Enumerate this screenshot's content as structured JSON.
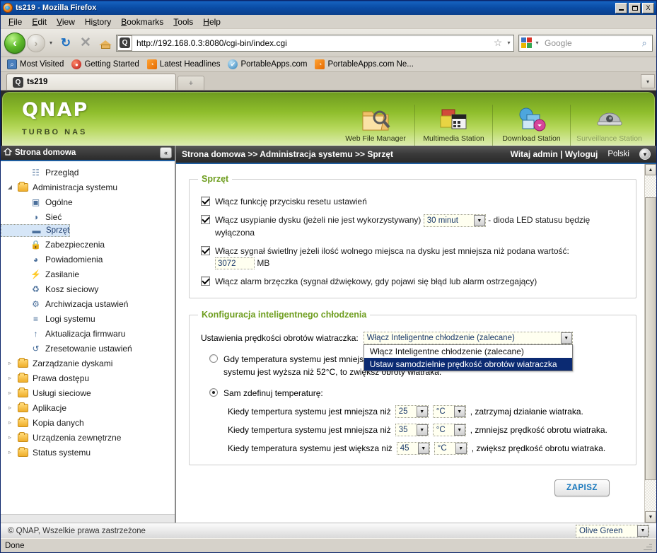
{
  "window": {
    "title": "ts219 - Mozilla Firefox",
    "icon": "firefox-icon",
    "minimize": "minimize-button",
    "maximize": "maximize-button",
    "close_label": "X"
  },
  "menu": [
    "File",
    "Edit",
    "View",
    "History",
    "Bookmarks",
    "Tools",
    "Help"
  ],
  "toolbar": {
    "back": "‹",
    "forward": "›",
    "dropdown": "▾",
    "reload": "↻",
    "stop": "✕",
    "url": "http://192.168.0.3:8080/cgi-bin/index.cgi",
    "star": "☆",
    "url_caret": "▾",
    "search_placeholder": "Google",
    "search_value": "",
    "magnifier": "⌕"
  },
  "bookmarks": [
    {
      "label": "Most Visited",
      "icon": "magnifier-bookmark-icon",
      "glyph": "⌕"
    },
    {
      "label": "Getting Started",
      "icon": "firefox-bookmark-icon",
      "glyph": "●"
    },
    {
      "label": "Latest Headlines",
      "icon": "rss-icon",
      "glyph": "◔"
    },
    {
      "label": "PortableApps.com",
      "icon": "portableapps-icon",
      "glyph": "✔"
    },
    {
      "label": "PortableApps.com Ne...",
      "icon": "rss-icon",
      "glyph": "◔"
    }
  ],
  "tabs": {
    "active": {
      "label": "ts219",
      "icon": "qnap-favicon",
      "favicon_glyph": "Q"
    },
    "new_tab": "+",
    "list_all": "▾"
  },
  "banner": {
    "brand": "QNAP",
    "tagline": "TURBO NAS",
    "apps": [
      {
        "label": "Web File Manager",
        "icon": "folder-search-icon",
        "glyph": "📂",
        "enabled": true
      },
      {
        "label": "Multimedia Station",
        "icon": "multimedia-icon",
        "glyph": "🎬",
        "enabled": true
      },
      {
        "label": "Download Station",
        "icon": "download-icon",
        "glyph": "🖧",
        "enabled": true
      },
      {
        "label": "Surveillance Station",
        "icon": "camera-dome-icon",
        "glyph": "●",
        "enabled": false
      }
    ]
  },
  "sidebar": {
    "header": "Strona domowa",
    "home_icon": "home-icon",
    "collapse_icon": "collapse-left-icon",
    "collapse_glyph": "«",
    "items": [
      {
        "label": "Przegląd",
        "level": 2,
        "icon": "overview-icon",
        "glyph": "☷",
        "arrow": "",
        "selected": false
      },
      {
        "label": "Administracja systemu",
        "level": 1,
        "icon": "folder-open-icon",
        "glyph": "",
        "arrow": "◢",
        "selected": false,
        "folder": true
      },
      {
        "label": "Ogólne",
        "level": 2,
        "icon": "general-icon",
        "glyph": "▣",
        "arrow": "",
        "selected": false
      },
      {
        "label": "Sieć",
        "level": 2,
        "icon": "network-icon",
        "glyph": "◑",
        "arrow": "",
        "selected": false
      },
      {
        "label": "Sprzęt",
        "level": 2,
        "icon": "hardware-icon",
        "glyph": "▬",
        "arrow": "",
        "selected": true
      },
      {
        "label": "Zabezpieczenia",
        "level": 2,
        "icon": "lock-icon",
        "glyph": "🔒",
        "arrow": "",
        "selected": false
      },
      {
        "label": "Powiadomienia",
        "level": 2,
        "icon": "notification-icon",
        "glyph": "◕",
        "arrow": "",
        "selected": false
      },
      {
        "label": "Zasilanie",
        "level": 2,
        "icon": "power-icon",
        "glyph": "⚡",
        "arrow": "",
        "selected": false
      },
      {
        "label": "Kosz sieciowy",
        "level": 2,
        "icon": "recycle-bin-icon",
        "glyph": "♻",
        "arrow": "",
        "selected": false
      },
      {
        "label": "Archiwizacja ustawień",
        "level": 2,
        "icon": "backup-icon",
        "glyph": "⚙",
        "arrow": "",
        "selected": false
      },
      {
        "label": "Logi systemu",
        "level": 2,
        "icon": "system-log-icon",
        "glyph": "≡",
        "arrow": "",
        "selected": false
      },
      {
        "label": "Aktualizacja firmwaru",
        "level": 2,
        "icon": "firmware-update-icon",
        "glyph": "↑",
        "arrow": "",
        "selected": false
      },
      {
        "label": "Zresetowanie ustawień",
        "level": 2,
        "icon": "reset-icon",
        "glyph": "↺",
        "arrow": "",
        "selected": false
      },
      {
        "label": "Zarządzanie dyskami",
        "level": 1,
        "icon": "folder-icon",
        "glyph": "",
        "arrow": "▹",
        "selected": false,
        "folder": true
      },
      {
        "label": "Prawa dostępu",
        "level": 1,
        "icon": "folder-icon",
        "glyph": "",
        "arrow": "▹",
        "selected": false,
        "folder": true
      },
      {
        "label": "Usługi sieciowe",
        "level": 1,
        "icon": "folder-icon",
        "glyph": "",
        "arrow": "▹",
        "selected": false,
        "folder": true
      },
      {
        "label": "Aplikacje",
        "level": 1,
        "icon": "folder-icon",
        "glyph": "",
        "arrow": "▹",
        "selected": false,
        "folder": true
      },
      {
        "label": "Kopia danych",
        "level": 1,
        "icon": "folder-icon",
        "glyph": "",
        "arrow": "▹",
        "selected": false,
        "folder": true
      },
      {
        "label": "Urządzenia zewnętrzne",
        "level": 1,
        "icon": "folder-icon",
        "glyph": "",
        "arrow": "▹",
        "selected": false,
        "folder": true
      },
      {
        "label": "Status systemu",
        "level": 1,
        "icon": "folder-icon",
        "glyph": "",
        "arrow": "▹",
        "selected": false,
        "folder": true
      }
    ]
  },
  "breadcrumb": {
    "path": "Strona domowa >> Administracja systemu >> Sprzęt",
    "greeting": "Witaj admin | Wyloguj",
    "language": "Polski",
    "language_icon": "globe-dropdown-icon",
    "language_glyph": "▼"
  },
  "hardware": {
    "legend": "Sprzęt",
    "reset_button": {
      "label": "Włącz funkcję przycisku resetu ustawień",
      "checked": true
    },
    "disk_standby": {
      "label_before": "Włącz usypianie dysku (jeżeli nie jest wykorzystywany)",
      "label_after": "- dioda LED statusu będzię wyłączona",
      "checked": true,
      "value": "30 minut",
      "arrow": "▼"
    },
    "free_space_alert": {
      "label": "Włącz sygnał świetlny jeżeli ilość wolnego miejsca na dysku jest mniejsza niż podana wartość:",
      "checked": true,
      "value": "3072",
      "unit": "MB"
    },
    "buzzer": {
      "label": "Włącz alarm brzęczka (sygnał dźwiękowy, gdy pojawi się błąd lub alarm ostrzegający)",
      "checked": true
    }
  },
  "cooling": {
    "legend": "Konfiguracja inteligentnego chłodzenia",
    "fan_speed_label": "Ustawienia prędkości obrotów wiatraczka:",
    "fan_speed_value": "Włącz Inteligentne chłodzenie (zalecane)",
    "fan_speed_arrow": "▼",
    "dropdown_open": true,
    "fan_speed_options": [
      {
        "label": "Włącz Inteligentne chłodzenie (zalecane)",
        "highlighted": false
      },
      {
        "label": "Ustaw samodzielnie prędkość obrotów wiatraczka",
        "highlighted": true
      }
    ],
    "mode_auto": {
      "label_line1": "Gdy temperatura systemu jest mniejsza niż 40°C, to zatrzymaj wiatrak. Jeżeli temperatura",
      "label_line2": "systemu jest wyższa niż 52°C, to zwiększ obroty wiatraka.",
      "selected": false
    },
    "mode_manual": {
      "label": "Sam zdefinuj temperaturę:",
      "selected": true
    },
    "rules": [
      {
        "prefix": "Kiedy tempertura systemu jest mniejsza niż",
        "value": "25",
        "unit": "°C",
        "suffix": ", zatrzymaj działanie wiatraka."
      },
      {
        "prefix": "Kiedy tempertura systemu jest mniejsza niż",
        "value": "35",
        "unit": "°C",
        "suffix": ", zmniejsz prędkość obrotu wiatraka."
      },
      {
        "prefix": "Kiedy temperatura systemu jest większa niż",
        "value": "45",
        "unit": "°C",
        "suffix": ", zwiększ prędkość obrotu wiatraka."
      }
    ],
    "save_label": "ZAPISZ"
  },
  "page_footer": {
    "copyright": "© QNAP, Wszelkie prawa zastrzeżone",
    "theme_value": "Olive Green",
    "theme_arrow": "▼"
  },
  "statusbar": {
    "text": "Done"
  },
  "scrollbar": {
    "up": "▲",
    "down": "▼"
  },
  "colors": {
    "accent_green": "#6f9e20",
    "banner_green": "#8fbe2c",
    "titlebar_blue": "#0a4ca5",
    "highlight_navy": "#0b2a72",
    "save_text": "#1878bd",
    "selected_row": "#d6e6f7"
  }
}
